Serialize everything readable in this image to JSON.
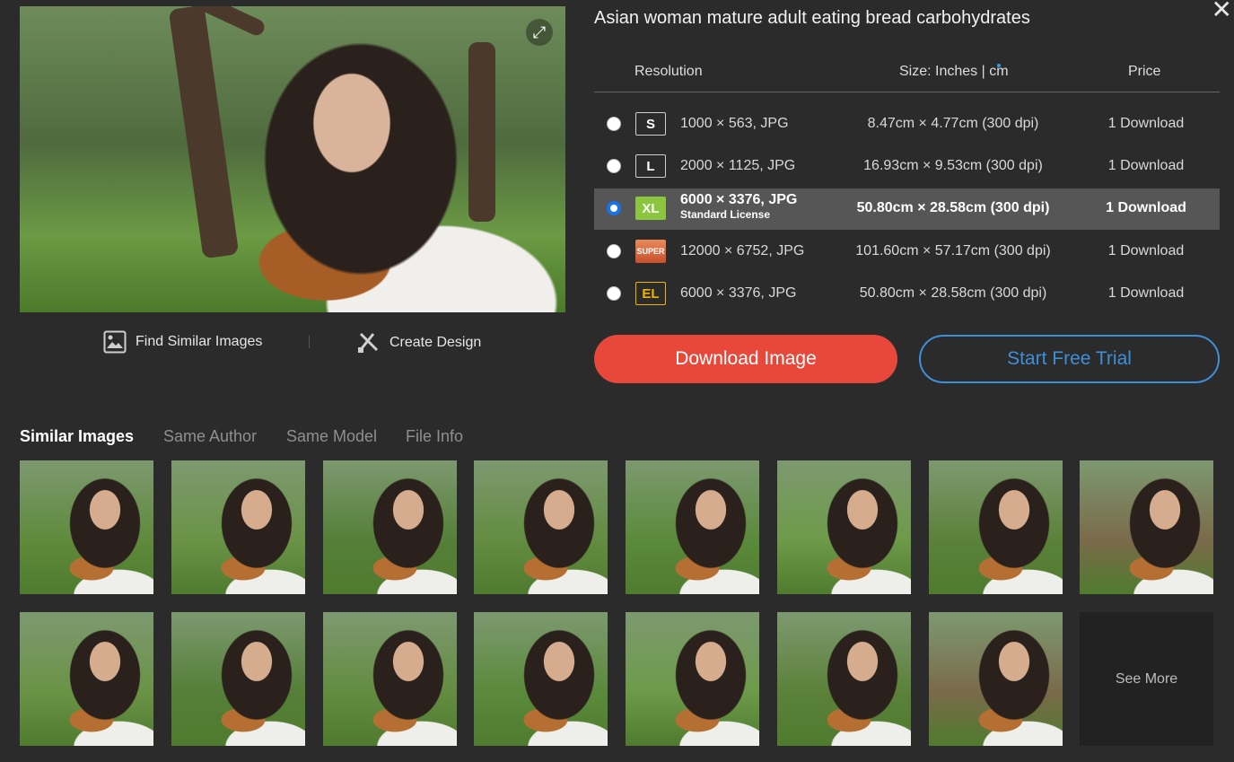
{
  "title": "Asian woman mature adult eating bread carbohydrates",
  "preview": {
    "alt": "Asian woman mature adult eating bread carbohydrates"
  },
  "actions": {
    "find_similar": "Find Similar Images",
    "create_design": "Create Design"
  },
  "table": {
    "headers": {
      "resolution": "Resolution",
      "size": "Size: Inches | cm",
      "price": "Price"
    },
    "rows": [
      {
        "badge": "S",
        "resolution": "1000 × 563, JPG",
        "size": "8.47cm × 4.77cm (300 dpi)",
        "price": "1 Download"
      },
      {
        "badge": "L",
        "resolution": "2000 × 1125, JPG",
        "size": "16.93cm × 9.53cm (300 dpi)",
        "price": "1 Download"
      },
      {
        "badge": "XL",
        "resolution": "6000 × 3376, JPG",
        "license": "Standard License",
        "size": "50.80cm × 28.58cm (300 dpi)",
        "price": "1 Download"
      },
      {
        "badge": "SUPER",
        "resolution": "12000 × 6752, JPG",
        "size": "101.60cm × 57.17cm (300 dpi)",
        "price": "1 Download"
      },
      {
        "badge": "EL",
        "resolution": "6000 × 3376, JPG",
        "size": "50.80cm × 28.58cm (300 dpi)",
        "price": "1 Download"
      }
    ],
    "selected_index": 2
  },
  "buttons": {
    "download": "Download Image",
    "trial": "Start Free Trial"
  },
  "tabs": [
    "Similar Images",
    "Same Author",
    "Same Model",
    "File Info"
  ],
  "see_more": "See More",
  "colors": {
    "download": "#e8483a",
    "trial": "#3d8fd8",
    "badge_xl": "#8cc63f",
    "badge_el": "#f0b400",
    "radio_selected": "#1a73e8"
  }
}
